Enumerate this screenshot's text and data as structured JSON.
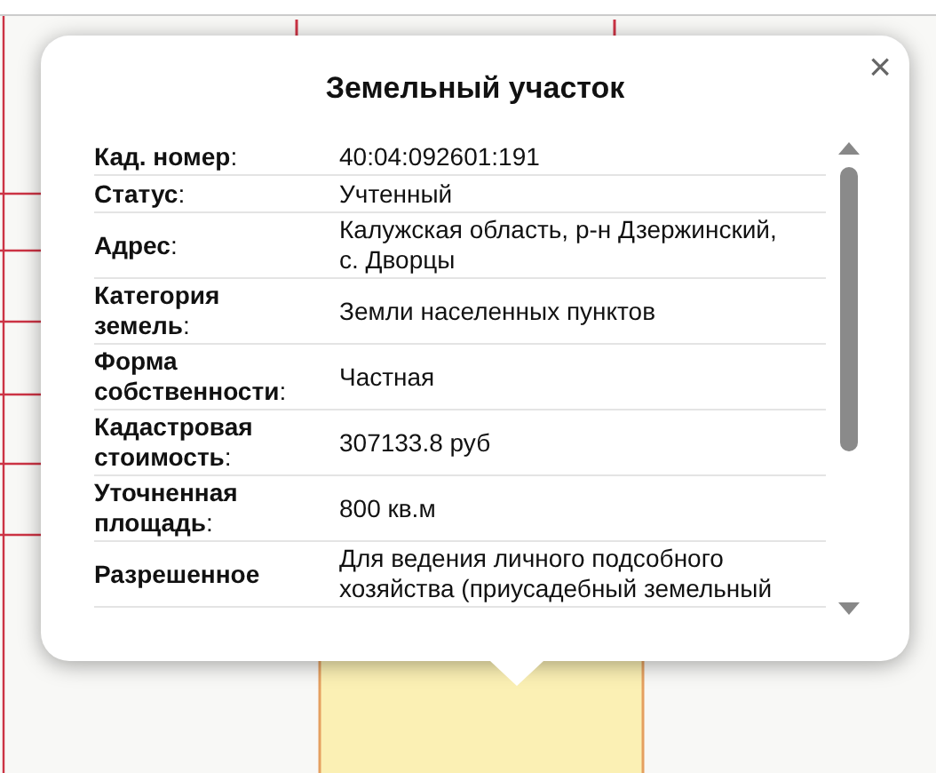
{
  "popup": {
    "title": "Земельный участок",
    "close": "×",
    "rows": [
      {
        "label": "**Кад. номер**:",
        "value": "40:04:092601:191"
      },
      {
        "label": "**Статус**:",
        "value": "Учтенный"
      },
      {
        "label": "**Адрес**:",
        "value": "Калужская область, р-н Дзержинский, с. Дворцы"
      },
      {
        "label": "**Категория земель**:",
        "value": "Земли населенных пунктов"
      },
      {
        "label": "**Форма собственности**:",
        "value": "Частная"
      },
      {
        "label": "**Кадастровая стоимость**:",
        "value": "307133.8 руб"
      },
      {
        "label": "**Уточненная площадь**:",
        "value": "800 кв.м"
      },
      {
        "label": "**Разрешенное**",
        "value": "Для ведения личного подсобного хозяйства (приусадебный земельный"
      }
    ]
  }
}
